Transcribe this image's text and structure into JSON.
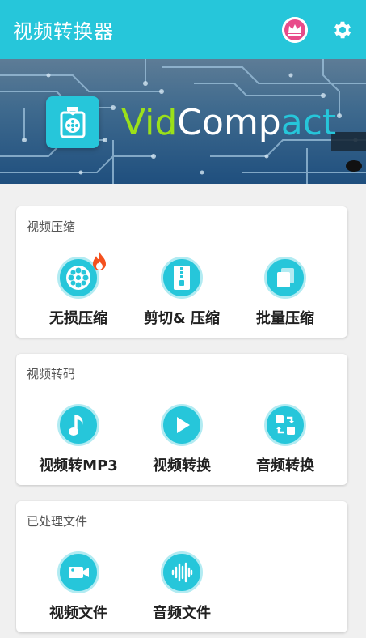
{
  "appbar": {
    "title": "视频转换器",
    "accent_color": "#26c6da",
    "crown_icon": "crown-icon",
    "settings_icon": "gear-icon"
  },
  "banner": {
    "brand_vid": "Vid",
    "brand_comp": "Comp",
    "brand_act": "act"
  },
  "sections": [
    {
      "title": "视频压缩",
      "items": [
        {
          "label": "无损压缩",
          "icon": "film-reel-icon",
          "badge": "fire-icon"
        },
        {
          "label": "剪切& 压缩",
          "icon": "zip-file-icon"
        },
        {
          "label": "批量压缩",
          "icon": "stack-files-icon"
        }
      ]
    },
    {
      "title": "视频转码",
      "items": [
        {
          "label": "视频转MP3",
          "icon": "music-note-icon"
        },
        {
          "label": "视频转换",
          "icon": "play-icon"
        },
        {
          "label": "音频转换",
          "icon": "convert-icon"
        }
      ]
    },
    {
      "title": "已处理文件",
      "items": [
        {
          "label": "视频文件",
          "icon": "video-camera-icon"
        },
        {
          "label": "音频文件",
          "icon": "waveform-icon"
        }
      ]
    }
  ]
}
